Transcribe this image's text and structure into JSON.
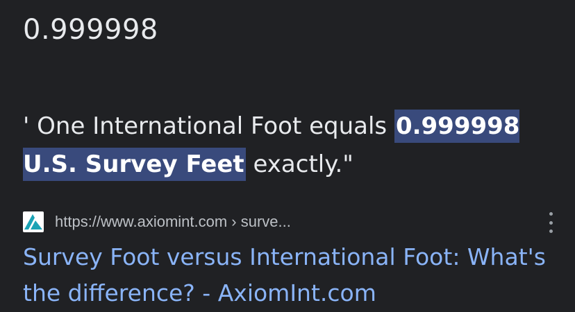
{
  "answer": {
    "value": "0.999998"
  },
  "snippet": {
    "before": "' One International Foot equals ",
    "highlight": "0.999998 U.S. Survey Feet",
    "after": " exactly.\""
  },
  "result": {
    "favicon": "axiomint-logo-icon",
    "url": "https://www.axiomint.com › surve...",
    "title": "Survey Foot versus International Foot: What's the difference? - AxiomInt.com",
    "more_icon": "more-vert-icon"
  },
  "colors": {
    "background": "#202124",
    "text": "#e8eaed",
    "highlight_bg": "#394a7c",
    "link": "#8ab4f8",
    "url_text": "#bdc1c6",
    "favicon_teal": "#1aa3b5"
  }
}
